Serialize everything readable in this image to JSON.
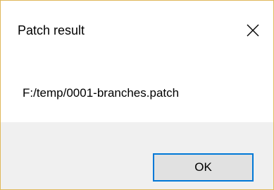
{
  "dialog": {
    "title": "Patch result",
    "close_icon": "close-icon",
    "message": "F:/temp/0001-branches.patch",
    "ok_label": "OK"
  },
  "colors": {
    "window_border": "#e0b85a",
    "footer_background": "#f0f0f0",
    "button_background": "#e1e1e1",
    "button_focus_border": "#0078d7"
  }
}
